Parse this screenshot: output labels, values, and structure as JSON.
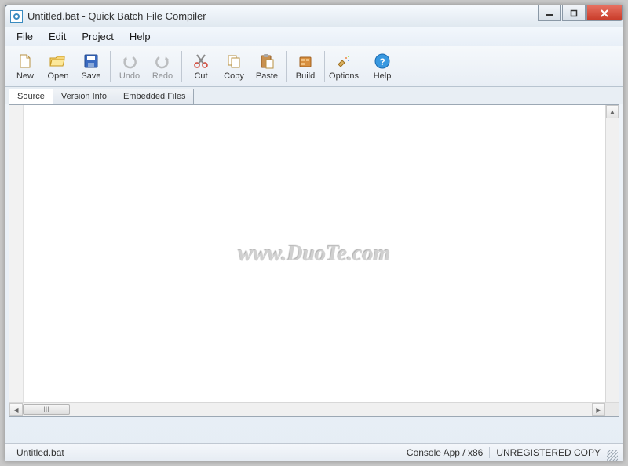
{
  "window": {
    "title": "Untitled.bat - Quick Batch File Compiler"
  },
  "menu": {
    "items": [
      "File",
      "Edit",
      "Project",
      "Help"
    ]
  },
  "toolbar": {
    "new": "New",
    "open": "Open",
    "save": "Save",
    "undo": "Undo",
    "redo": "Redo",
    "cut": "Cut",
    "copy": "Copy",
    "paste": "Paste",
    "build": "Build",
    "options": "Options",
    "help": "Help"
  },
  "tabs": {
    "source": "Source",
    "version_info": "Version Info",
    "embedded_files": "Embedded Files"
  },
  "watermark": "www.DuoTe.com",
  "hscroll_text": "III",
  "status": {
    "file": "Untitled.bat",
    "target": "Console App / x86",
    "license": "UNREGISTERED COPY"
  }
}
